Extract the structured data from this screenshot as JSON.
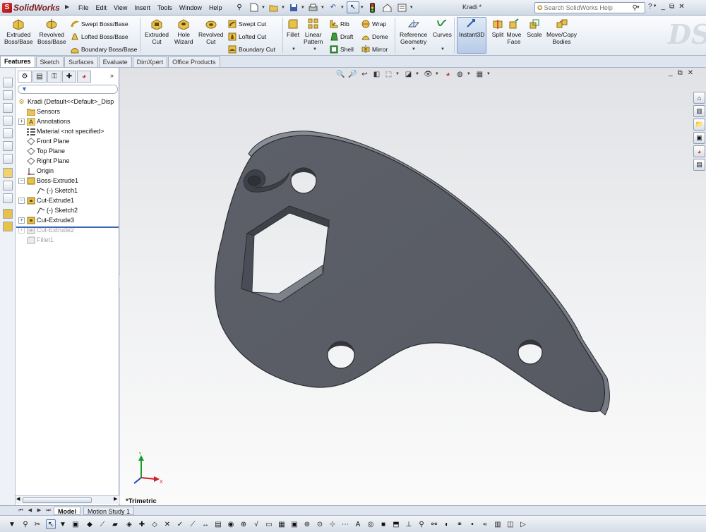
{
  "app": {
    "logo_text": "SolidWorks",
    "document_title": "Kradi *",
    "menu": [
      "File",
      "Edit",
      "View",
      "Insert",
      "Tools",
      "Window",
      "Help"
    ],
    "search_placeholder": "Search SolidWorks Help",
    "help_icon": "?"
  },
  "ribbon": {
    "extruded_boss": "Extruded\nBoss/Base",
    "revolved_boss": "Revolved\nBoss/Base",
    "swept_boss": "Swept Boss/Base",
    "lofted_boss": "Lofted Boss/Base",
    "boundary_boss": "Boundary Boss/Base",
    "extruded_cut": "Extruded\nCut",
    "hole_wizard": "Hole\nWizard",
    "revolved_cut": "Revolved\nCut",
    "swept_cut": "Swept Cut",
    "lofted_cut": "Lofted Cut",
    "boundary_cut": "Boundary Cut",
    "fillet": "Fillet",
    "linear_pattern": "Linear\nPattern",
    "rib": "Rib",
    "draft": "Draft",
    "shell": "Shell",
    "wrap": "Wrap",
    "dome": "Dome",
    "mirror": "Mirror",
    "reference_geometry": "Reference\nGeometry",
    "curves": "Curves",
    "instant3d": "Instant3D",
    "split": "Split",
    "move_face": "Move\nFace",
    "scale": "Scale",
    "move_copy_bodies": "Move/Copy\nBodies"
  },
  "command_tabs": [
    "Features",
    "Sketch",
    "Surfaces",
    "Evaluate",
    "DimXpert",
    "Office Products"
  ],
  "feature_tree": {
    "root": "Kradi  (Default<<Default>_Disp",
    "items": [
      {
        "label": "Sensors"
      },
      {
        "label": "Annotations"
      },
      {
        "label": "Material <not specified>"
      },
      {
        "label": "Front Plane"
      },
      {
        "label": "Top Plane"
      },
      {
        "label": "Right Plane"
      },
      {
        "label": "Origin"
      },
      {
        "label": "Boss-Extrude1"
      },
      {
        "label": "(-) Sketch1"
      },
      {
        "label": "Cut-Extrude1"
      },
      {
        "label": "(-) Sketch2"
      },
      {
        "label": "Cut-Extrude3"
      },
      {
        "label": "Cut-Extrude2"
      },
      {
        "label": "Fillet1"
      }
    ]
  },
  "viewport": {
    "view_label": "*Trimetric",
    "part_color": "#5d6069",
    "axis_x": "X",
    "axis_y": "Y"
  },
  "bottom_tabs": [
    "Model",
    "Motion Study 1"
  ]
}
